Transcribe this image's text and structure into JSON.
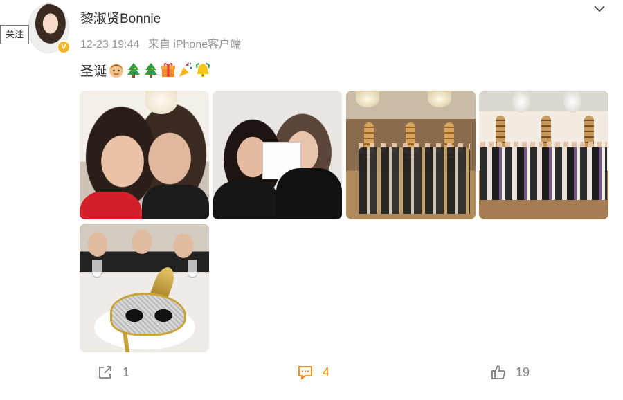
{
  "author": {
    "name": "黎淑贤Bonnie",
    "follow_label": "关注",
    "verified_icon": "verified-v-badge",
    "verified_mark": "V",
    "verified_color": "#f5b625"
  },
  "meta": {
    "time": "12-23 19:44",
    "source": "来自 iPhone客户端"
  },
  "post": {
    "text": "圣诞",
    "emojis": [
      "boy-face-icon",
      "christmas-tree-icon",
      "christmas-tree-icon",
      "gift-box-icon",
      "party-popper-icon",
      "bell-icon"
    ]
  },
  "photos": [
    {
      "name": "photo-1-selfie"
    },
    {
      "name": "photo-2-two-women"
    },
    {
      "name": "photo-3-group-hall"
    },
    {
      "name": "photo-4-group-hall-wide"
    },
    {
      "name": "photo-5-masquerade-mask"
    }
  ],
  "actions": {
    "repost_count": "1",
    "comment_count": "4",
    "like_count": "19",
    "comment_color": "#ff8200"
  }
}
